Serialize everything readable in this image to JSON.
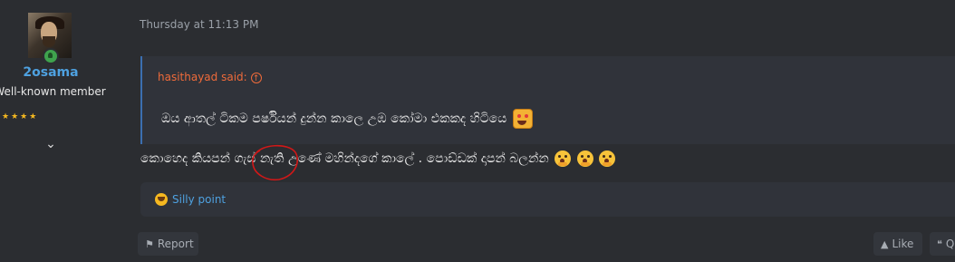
{
  "user": {
    "username": "2osama",
    "title": "Well-known member",
    "stars": "★★★★"
  },
  "post": {
    "timestamp": "Thursday at 11:13 PM",
    "quote": {
      "author_label": "hasithayad said:",
      "text": "ඔය ආතල් ටිකම පර්ෂියන් දුන්න කාලෙ උඹ කෝමා එකකද හිටියෙ"
    },
    "message": "කොහෙද කියපන් ගැස් නැති උණේ මහින්දගේ කාලේ . පොඩ්ඩක් දාපන් බලන්න"
  },
  "reactions": {
    "label": "Silly point"
  },
  "actions": {
    "report": "Report",
    "like": "Like",
    "quote": "Q"
  },
  "colors": {
    "background": "#2b2d31",
    "panel": "#30333a",
    "link": "#4ea1e0",
    "quote_author": "#ef6b3a",
    "quote_border": "#3b6fb0",
    "annotation": "#d01818"
  },
  "icons": [
    "online-status-icon",
    "chevron-down-icon",
    "jump-to-quote-icon",
    "grin-emoji-icon",
    "hush-emoji-icon",
    "silly-reaction-icon",
    "flag-icon",
    "thumbs-up-icon",
    "quote-icon"
  ]
}
